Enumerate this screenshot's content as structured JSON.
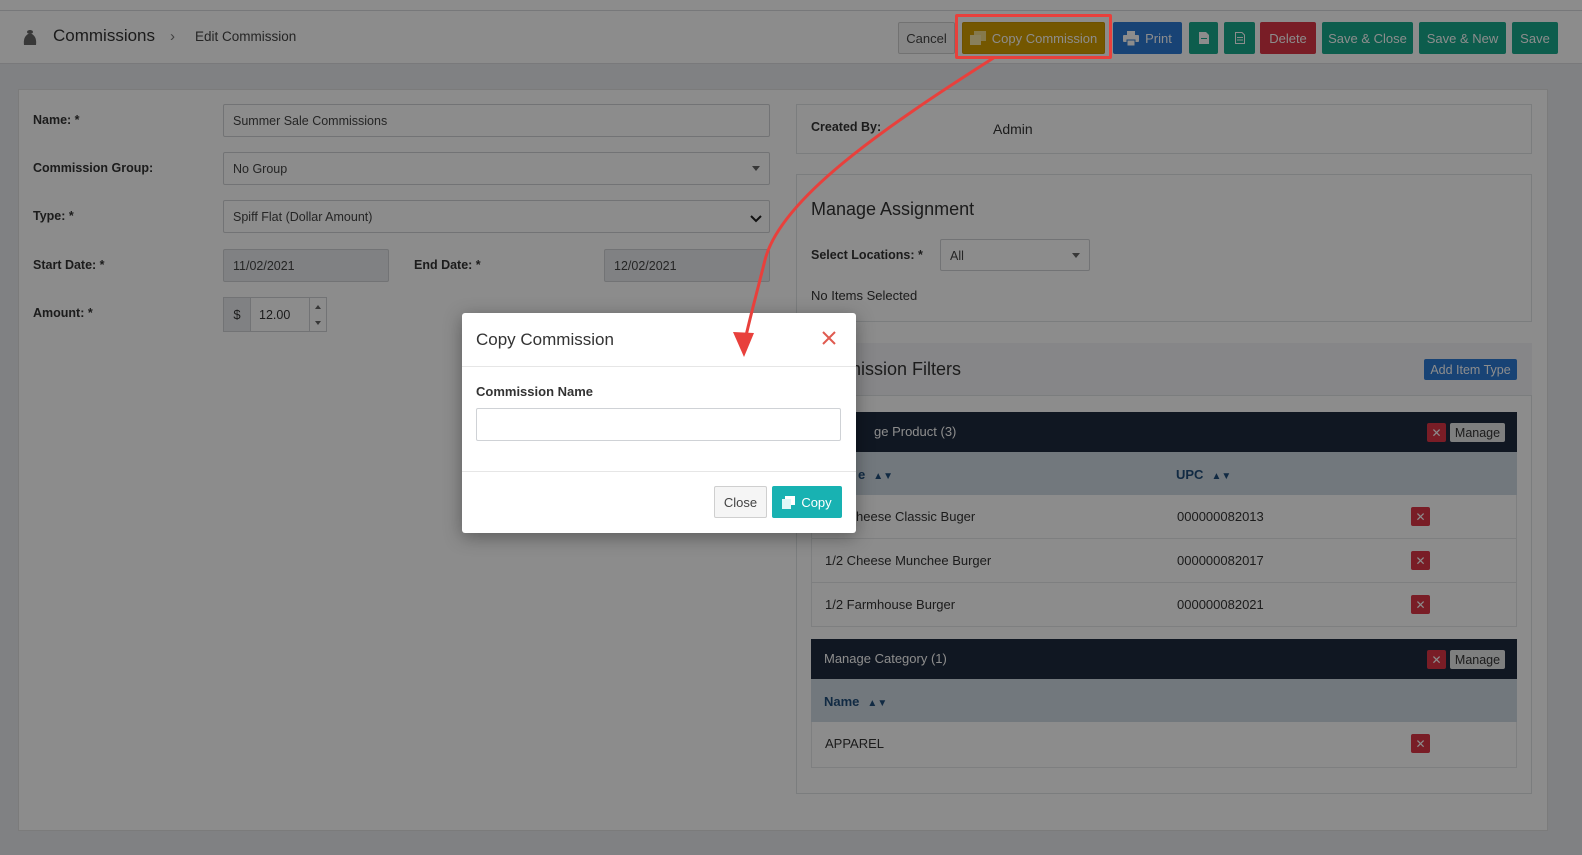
{
  "header": {
    "app_title": "Commissions",
    "breadcrumb_current": "Edit Commission",
    "buttons": {
      "cancel": "Cancel",
      "copy_commission": "Copy Commission",
      "print": "Print",
      "delete": "Delete",
      "save_close": "Save & Close",
      "save_new": "Save & New",
      "save": "Save"
    }
  },
  "form": {
    "name_label": "Name: *",
    "name_value": "Summer Sale Commissions",
    "group_label": "Commission Group:",
    "group_value": "No Group",
    "type_label": "Type: *",
    "type_value": "Spiff Flat (Dollar Amount)",
    "start_label": "Start Date: *",
    "start_value": "11/02/2021",
    "end_label": "End Date: *",
    "end_value": "12/02/2021",
    "amount_label": "Amount: *",
    "amount_prefix": "$",
    "amount_value": "12.00"
  },
  "created": {
    "label": "Created By:",
    "value": "Admin"
  },
  "assignment": {
    "title": "Manage Assignment",
    "locations_label": "Select Locations: *",
    "locations_value": "All",
    "no_items": "No Items Selected"
  },
  "filters": {
    "title_visible": "nission Filters",
    "add_item_type": "Add Item Type",
    "product_section": {
      "title_visible": "ge Product (3)",
      "manage": "Manage",
      "col_name_visible": "e",
      "col_upc": "UPC",
      "rows": [
        {
          "name": "heese Classic Buger",
          "upc": "000000082013"
        },
        {
          "name": "1/2 Cheese Munchee Burger",
          "upc": "000000082017"
        },
        {
          "name": "1/2 Farmhouse Burger",
          "upc": "000000082021"
        }
      ]
    },
    "category_section": {
      "title": "Manage Category (1)",
      "manage": "Manage",
      "col_name": "Name",
      "rows": [
        {
          "name": "APPAREL"
        }
      ]
    }
  },
  "modal": {
    "title": "Copy Commission",
    "field_label": "Commission Name",
    "field_value": "",
    "close": "Close",
    "copy": "Copy"
  },
  "colors": {
    "copy_button": "#d39e00",
    "highlight": "#e8403c",
    "teal": "#18a98c",
    "blue": "#2d7ad6",
    "danger": "#dc3545",
    "dark_header": "#1e2a3e"
  }
}
